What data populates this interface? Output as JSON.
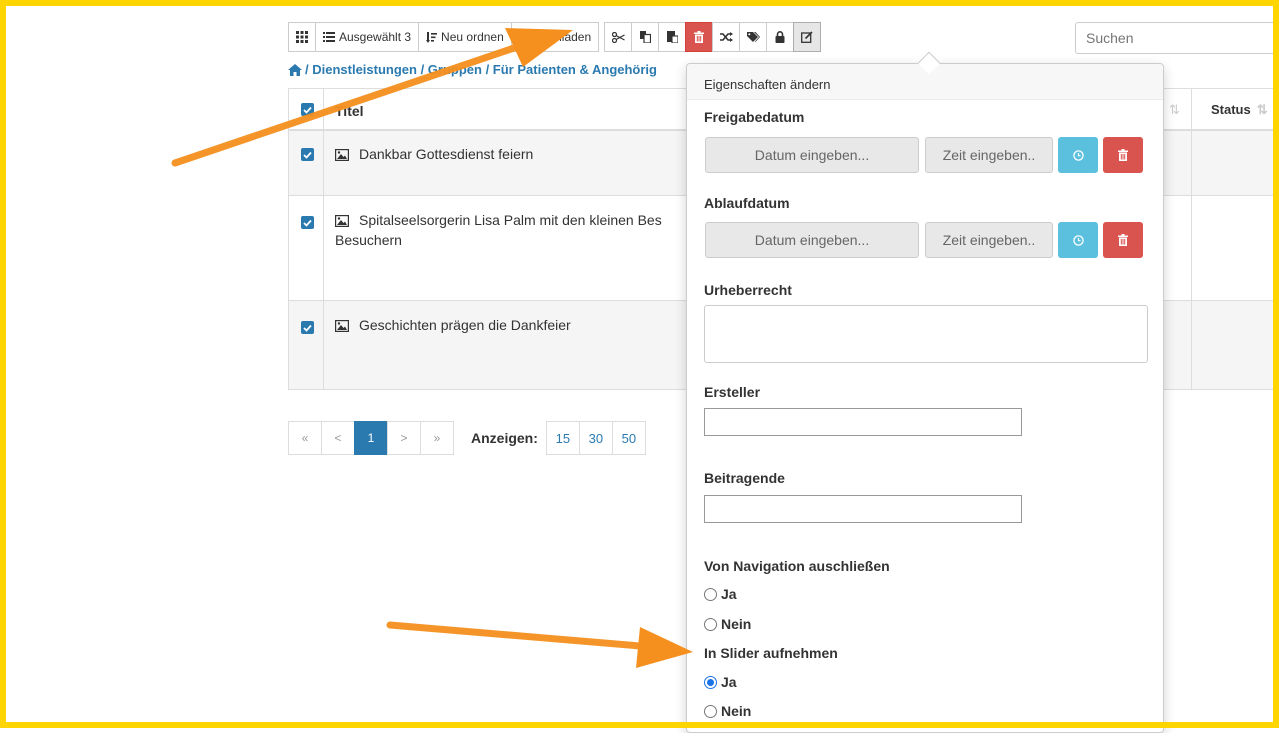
{
  "toolbar": {
    "selected_label": "Ausgewählt 3",
    "reorder_label": "Neu ordnen",
    "upload_label": "Hochladen"
  },
  "search": {
    "placeholder": "Suchen"
  },
  "breadcrumb": {
    "text": "/ Dienstleistungen / Gruppen / Für Patienten & Angehörig"
  },
  "table": {
    "headers": {
      "title": "Titel",
      "status": "Status"
    },
    "rows": [
      {
        "title": "Dankbar Gottesdienst feiern"
      },
      {
        "title": "Spitalseelsorgerin Lisa Palm mit den kleinen Bes",
        "title_cont": "Besuchern"
      },
      {
        "title": "Geschichten prägen die Dankfeier"
      }
    ]
  },
  "pager": {
    "first": "«",
    "prev": "<",
    "current": "1",
    "next": ">",
    "last": "»",
    "show_label": "Anzeigen:",
    "sizes": [
      "15",
      "30",
      "50"
    ]
  },
  "popover": {
    "title": "Eigenschaften ändern",
    "release_label": "Freigabedatum",
    "expiry_label": "Ablaufdatum",
    "date_placeholder": "Datum eingeben...",
    "time_placeholder": "Zeit eingeben..",
    "copyright_label": "Urheberrecht",
    "creator_label": "Ersteller",
    "contributors_label": "Beitragende",
    "exclude_nav_label": "Von Navigation auschließen",
    "slider_label": "In Slider aufnehmen",
    "yes": "Ja",
    "no": "Nein"
  },
  "colors": {
    "frame": "#ffd500",
    "accent": "#2a7ab0",
    "danger": "#d9534f",
    "info": "#5bc0de",
    "arrow": "#f5901e"
  }
}
